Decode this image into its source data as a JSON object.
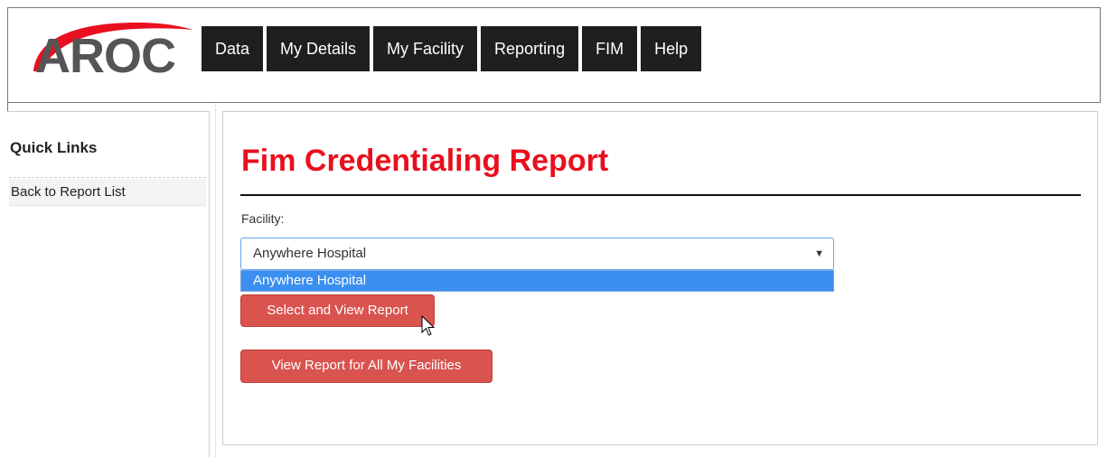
{
  "logo": {
    "text": "AROC",
    "icon": "aroc-logo-swoosh",
    "colors": {
      "swoosh": "#e8101e",
      "text": "#555555"
    }
  },
  "nav": {
    "items": [
      {
        "label": "Data"
      },
      {
        "label": "My Details"
      },
      {
        "label": "My Facility"
      },
      {
        "label": "Reporting"
      },
      {
        "label": "FIM"
      },
      {
        "label": "Help"
      }
    ]
  },
  "sidebar": {
    "title": "Quick Links",
    "links": [
      {
        "label": "Back to Report List"
      }
    ]
  },
  "main": {
    "title": "Fim Credentialing Report",
    "facility_label": "Facility:",
    "facility_select": {
      "selected": "Anywhere Hospital",
      "options": [
        "Anywhere Hospital"
      ],
      "arrow_icon": "dropdown-arrow-icon"
    },
    "select_button": "Select and View Report",
    "all_button": "View Report for All My Facilities"
  },
  "colors": {
    "title": "#e8101e",
    "nav_bg": "#1f1f1f",
    "button_bg": "#d9534f",
    "option_highlight": "#3b8ff0"
  }
}
